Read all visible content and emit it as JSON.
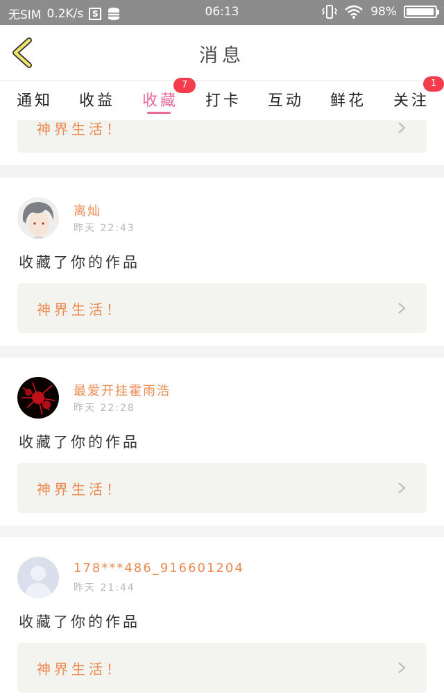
{
  "status_bar": {
    "carrier": "无SIM",
    "speed": "0.2K/s",
    "time": "06:13",
    "battery": "98%",
    "battery_level": 0.98
  },
  "header": {
    "title": "消息",
    "back_icon": "chevron-left-icon"
  },
  "tabs": [
    {
      "label": "通知",
      "badge": ""
    },
    {
      "label": "收益",
      "badge": ""
    },
    {
      "label": "收藏",
      "badge": "7",
      "active": true
    },
    {
      "label": "打卡",
      "badge": ""
    },
    {
      "label": "互动",
      "badge": ""
    },
    {
      "label": "鲜花",
      "badge": ""
    },
    {
      "label": "关注",
      "badge": "1"
    }
  ],
  "partial_card": {
    "work_title": "神界生活！"
  },
  "notifications": [
    {
      "username": "离灿",
      "time": "昨天 22:43",
      "action": "收藏了你的作品",
      "work_title": "神界生活！",
      "avatar": "anime-boy-avatar"
    },
    {
      "username": "最爱开挂霍雨浩",
      "time": "昨天 22:28",
      "action": "收藏了你的作品",
      "work_title": "神界生活！",
      "avatar": "red-flower-avatar"
    },
    {
      "username": "178***486_916601204",
      "time": "昨天 21:44",
      "action": "收藏了你的作品",
      "work_title": "神界生活！",
      "avatar": "default-user-avatar"
    }
  ],
  "colors": {
    "accent_pink": "#e86a9a",
    "name_orange": "#ec8a52",
    "badge_red": "#f43c4c",
    "back_yellow": "#f2e36a"
  }
}
